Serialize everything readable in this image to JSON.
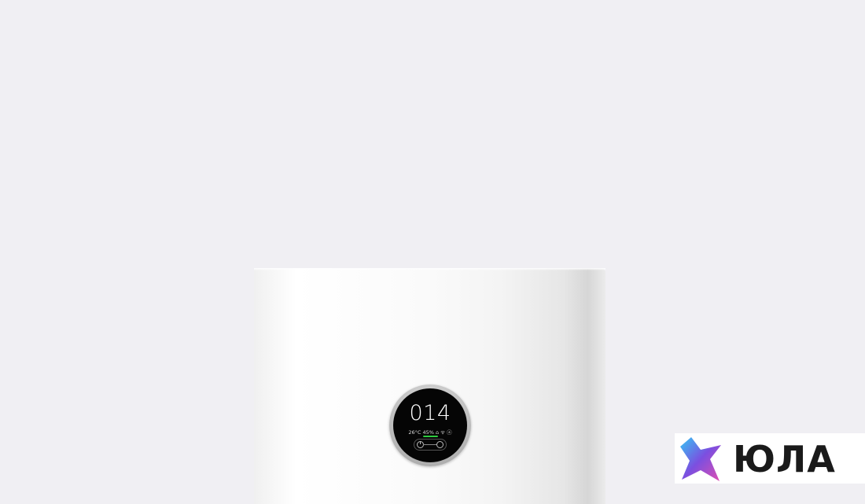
{
  "display": {
    "aqi_value": "014",
    "status_line": "26°C 45% ⌂ ᯤ ⓐ",
    "indicator_color": "#2ecc40"
  },
  "watermark": {
    "brand_text": "ЮЛА",
    "icon": "star-logo-icon"
  }
}
